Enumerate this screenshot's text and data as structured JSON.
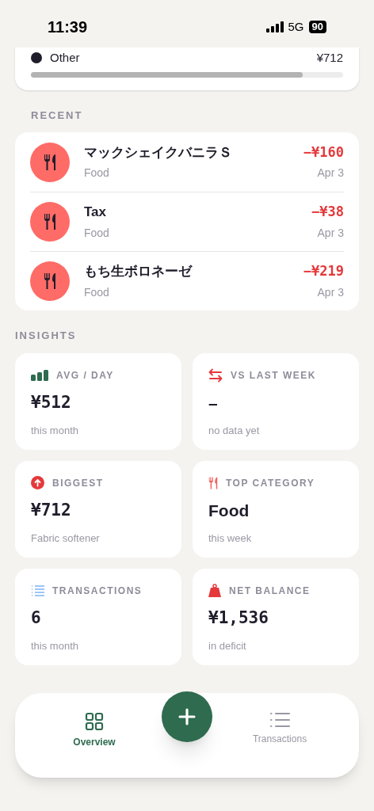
{
  "status_bar": {
    "time": "11:39",
    "network": "5G",
    "battery": "90"
  },
  "category_row": {
    "name": "Other",
    "amount": "¥712",
    "level": 0.87
  },
  "recent": {
    "title": "RECENT",
    "items": [
      {
        "name": "マックシェイクバニラＳ",
        "category": "Food",
        "amount": "−¥160",
        "date": "Apr 3"
      },
      {
        "name": "Tax",
        "category": "Food",
        "amount": "−¥38",
        "date": "Apr 3"
      },
      {
        "name": "もち生ボロネーゼ",
        "category": "Food",
        "amount": "−¥219",
        "date": "Apr 3"
      }
    ]
  },
  "insights": {
    "title": "INSIGHTS",
    "cards": [
      {
        "kind": "avg",
        "label": "AVG / DAY",
        "value": "¥512",
        "note": "this month"
      },
      {
        "kind": "compare",
        "label": "VS LAST WEEK",
        "value": "–",
        "note": "no data yet"
      },
      {
        "kind": "biggest",
        "label": "BIGGEST",
        "value": "¥712",
        "note": "Fabric softener"
      },
      {
        "kind": "category",
        "label": "TOP CATEGORY",
        "value": "Food",
        "note": "this week"
      },
      {
        "kind": "count",
        "label": "TRANSACTIONS",
        "value": "6",
        "note": "this month"
      },
      {
        "kind": "balance",
        "label": "NET BALANCE",
        "value": "¥1,536",
        "note": "in deficit"
      }
    ]
  },
  "nav": {
    "tabs": [
      {
        "label": "Overview",
        "selected": true
      },
      {
        "label": "Transactions",
        "selected": false
      }
    ]
  }
}
